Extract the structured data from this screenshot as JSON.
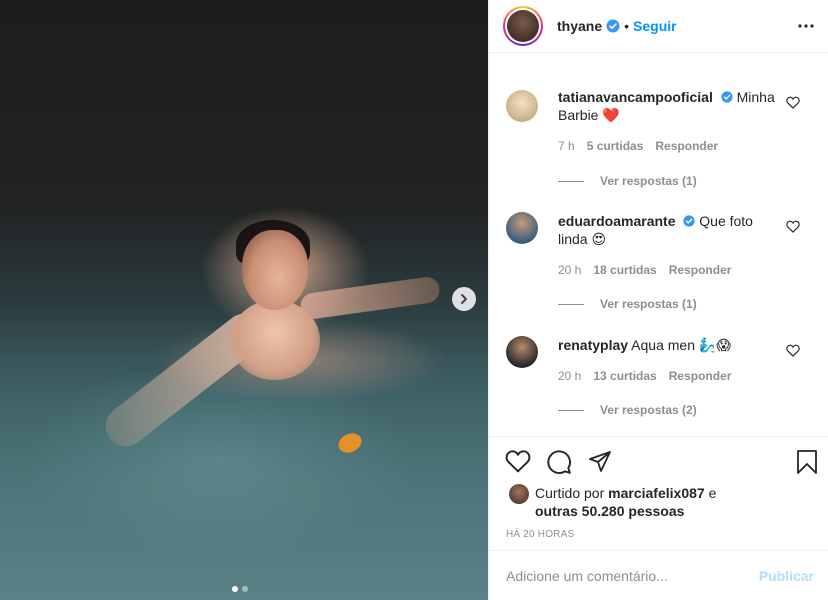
{
  "post": {
    "author": "thyane",
    "follow_label": "Seguir",
    "dot": "•",
    "carousel": {
      "slides": 2,
      "active": 1
    }
  },
  "comments": [
    {
      "username": "tatianavancampooficial",
      "verified": true,
      "text": "Minha Barbie",
      "emoji": "❤️",
      "time": "7 h",
      "likes": "5 curtidas",
      "reply_label": "Responder",
      "view_replies": "Ver respostas (1)"
    },
    {
      "username": "eduardoamarante",
      "verified": true,
      "text": "Que foto linda",
      "emoji": "😍",
      "time": "20 h",
      "likes": "18 curtidas",
      "reply_label": "Responder",
      "view_replies": "Ver respostas (1)"
    },
    {
      "username": "renatyplay",
      "verified": false,
      "text": "Aqua men",
      "emoji": "🧞‍♂️😱",
      "time": "20 h",
      "likes": "13 curtidas",
      "reply_label": "Responder",
      "view_replies": "Ver respostas (2)"
    }
  ],
  "likes": {
    "prefix": "Curtido por",
    "user": "marciafelix087",
    "connector": "e",
    "others": "outras 50.280 pessoas"
  },
  "time_ago": "HÁ 20 HORAS",
  "comment_box": {
    "placeholder": "Adicione um comentário...",
    "publish_label": "Publicar"
  },
  "colors": {
    "accent": "#0095f6",
    "publish_disabled": "#b2dffc",
    "muted": "#8e8e8e",
    "heart": "#ed4956"
  }
}
